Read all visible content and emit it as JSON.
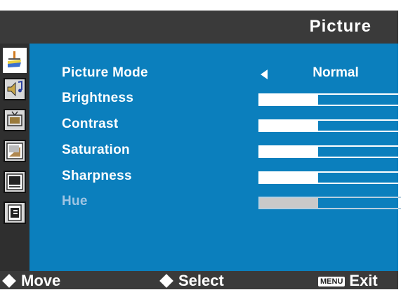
{
  "header": {
    "title": "Picture"
  },
  "sidebar": {
    "icons": [
      "picture-icon",
      "audio-icon",
      "tv-icon",
      "window-icon",
      "setup-icon",
      "feature-icon"
    ]
  },
  "menu": {
    "picture_mode": {
      "label": "Picture Mode",
      "value": "Normal"
    },
    "items": [
      {
        "label": "Brightness",
        "level": 0.4
      },
      {
        "label": "Contrast",
        "level": 0.4
      },
      {
        "label": "Saturation",
        "level": 0.4
      },
      {
        "label": "Sharpness",
        "level": 0.4
      },
      {
        "label": "Hue",
        "level": 0.4,
        "disabled": true
      }
    ]
  },
  "footer": {
    "move": "Move",
    "select": "Select",
    "menu_key": "MENU",
    "exit": "Exit"
  },
  "colors": {
    "panel": "#0b7fbd",
    "header": "#3a3a3a",
    "sidebar": "#2f2f2f",
    "text": "#ffffff"
  }
}
